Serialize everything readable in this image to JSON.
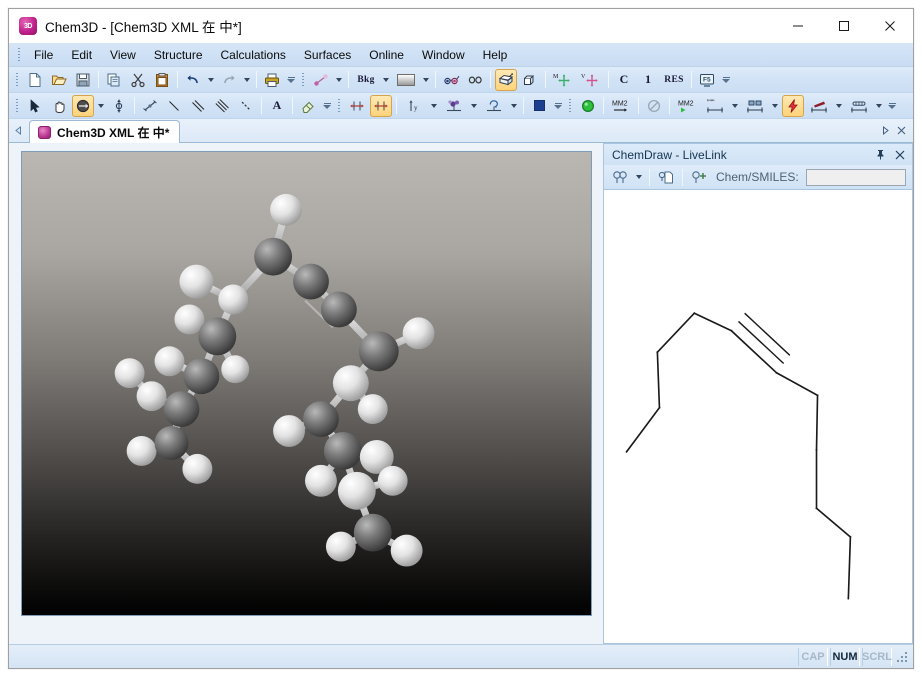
{
  "window": {
    "title": "Chem3D - [Chem3D XML 在  中*]",
    "app_icon_label": "3D",
    "controls": {
      "minimize": "Minimize",
      "maximize": "Maximize",
      "close": "Close"
    }
  },
  "menubar": {
    "items": [
      {
        "label": "File"
      },
      {
        "label": "Edit"
      },
      {
        "label": "View"
      },
      {
        "label": "Structure"
      },
      {
        "label": "Calculations"
      },
      {
        "label": "Surfaces"
      },
      {
        "label": "Online"
      },
      {
        "label": "Window"
      },
      {
        "label": "Help"
      }
    ]
  },
  "toolbar_main": {
    "buttons": [
      {
        "name": "new-document-button",
        "icon": "new-file-icon",
        "label": ""
      },
      {
        "name": "open-document-button",
        "icon": "open-folder-icon",
        "label": ""
      },
      {
        "name": "save-document-button",
        "icon": "save-disk-icon",
        "label": ""
      },
      {
        "name": "copy-button",
        "icon": "copy-icon",
        "label": ""
      },
      {
        "name": "cut-button",
        "icon": "scissors-icon",
        "label": ""
      },
      {
        "name": "paste-button",
        "icon": "clipboard-icon",
        "label": ""
      },
      {
        "name": "undo-button",
        "icon": "undo-arrow-icon",
        "label": ""
      },
      {
        "name": "redo-button",
        "icon": "redo-arrow-icon",
        "label": ""
      },
      {
        "name": "print-button",
        "icon": "printer-icon",
        "label": ""
      },
      {
        "name": "model-display-button",
        "icon": "ball-and-stick-icon",
        "label": ""
      },
      {
        "name": "background-color-button",
        "icon": "background-icon",
        "label": "Bkg"
      },
      {
        "name": "background-gradient-button",
        "icon": "gradient-swatch-icon",
        "label": ""
      },
      {
        "name": "stereo-glasses-button",
        "icon": "stereo-glasses-icon",
        "label": ""
      },
      {
        "name": "stereo-pair-button",
        "icon": "stereo-pair-icon",
        "label": ""
      },
      {
        "name": "perspective-box-button",
        "icon": "perspective-box-icon",
        "label": ""
      },
      {
        "name": "projection-box-button",
        "icon": "projection-box-icon",
        "label": ""
      },
      {
        "name": "move-model-button",
        "icon": "move-crosshair-icon",
        "label": "M"
      },
      {
        "name": "view-crosshair-button",
        "icon": "view-crosshair-icon",
        "label": "V"
      },
      {
        "name": "show-carbons-button",
        "icon": "carbon-label-icon",
        "label": "C"
      },
      {
        "name": "show-serial-numbers-button",
        "icon": "serial-number-icon",
        "label": "1"
      },
      {
        "name": "show-residues-button",
        "icon": "residue-label-icon",
        "label": "RES"
      },
      {
        "name": "fullscreen-button",
        "icon": "f5-screen-icon",
        "label": "F5"
      }
    ]
  },
  "toolbar_build": {
    "buttons": [
      {
        "name": "select-tool",
        "icon": "arrow-cursor-icon",
        "label": ""
      },
      {
        "name": "pan-tool",
        "icon": "hand-icon",
        "label": ""
      },
      {
        "name": "rotate-tool",
        "icon": "rotate-icon",
        "label": "",
        "active": true
      },
      {
        "name": "zoom-tool",
        "icon": "zoom-tool-icon",
        "label": ""
      },
      {
        "name": "translate-tool",
        "icon": "translate-icon",
        "label": ""
      },
      {
        "name": "single-bond-tool",
        "icon": "single-bond-icon",
        "label": ""
      },
      {
        "name": "double-bond-tool",
        "icon": "double-bond-icon",
        "label": ""
      },
      {
        "name": "triple-bond-tool",
        "icon": "triple-bond-icon",
        "label": ""
      },
      {
        "name": "dashed-bond-tool",
        "icon": "dashed-bond-icon",
        "label": ""
      },
      {
        "name": "text-tool",
        "icon": "text-a-icon",
        "label": "A"
      },
      {
        "name": "eraser-tool",
        "icon": "eraser-icon",
        "label": ""
      },
      {
        "name": "measure-distance-button",
        "icon": "measure-distance-icon",
        "label": ""
      },
      {
        "name": "measure-angle-button",
        "icon": "measure-angle-icon",
        "label": "",
        "active": true
      },
      {
        "name": "axis-tool-button",
        "icon": "axis-y-icon",
        "label": "y"
      },
      {
        "name": "atom-color-button",
        "icon": "atom-color-icon",
        "label": ""
      },
      {
        "name": "rotate-dial-button",
        "icon": "rotate-dial-icon",
        "label": ""
      },
      {
        "name": "solid-color-button",
        "icon": "solid-color-icon",
        "label": ""
      },
      {
        "name": "minimize-energy-button",
        "icon": "green-sphere-icon",
        "label": ""
      },
      {
        "name": "mm2-run-button",
        "icon": "mm2-arrow-icon",
        "label": "MM2"
      },
      {
        "name": "stop-calculation-button",
        "icon": "no-entry-icon",
        "label": ""
      },
      {
        "name": "mm2-play-button",
        "icon": "mm2-play-icon",
        "label": "MM2"
      },
      {
        "name": "trajectory-button",
        "icon": "trajectory-icon",
        "label": ""
      },
      {
        "name": "frames-button",
        "icon": "frames-icon",
        "label": ""
      },
      {
        "name": "lightning-button",
        "icon": "lightning-bolt-icon",
        "label": "",
        "active": true
      },
      {
        "name": "ribbon-button",
        "icon": "ribbon-icon",
        "label": ""
      },
      {
        "name": "capsule-button",
        "icon": "capsule-icon",
        "label": ""
      }
    ]
  },
  "document_tabs": {
    "scroll_left": "◁",
    "scroll_right": "▷",
    "close": "✕",
    "tabs": [
      {
        "label": "Chem3D XML 在  中*",
        "active": true
      }
    ]
  },
  "model_view": {
    "name": "3d-model-viewport",
    "background_top": "#bab7b2",
    "background_bottom": "#000000",
    "atom_carbon_color": "#6e6e6e",
    "atom_hydrogen_color": "#f2f2f2",
    "bond_color": "#cfcfcf"
  },
  "livelink": {
    "title": "ChemDraw - LiveLink",
    "pin": "📌",
    "close": "✕",
    "smiles_label": "Chem/SMILES:",
    "smiles_value": "",
    "smiles_placeholder": "",
    "toolbar_buttons": [
      {
        "name": "livelink-copy-structure-button",
        "icon": "double-ring-icon"
      },
      {
        "name": "livelink-paste-structure-button",
        "icon": "structure-page-icon"
      },
      {
        "name": "livelink-add-structure-button",
        "icon": "ring-plus-icon"
      }
    ],
    "structure_line_color": "#1a1a1a"
  },
  "statusbar": {
    "message": "",
    "indicators": [
      {
        "label": "CAP",
        "active": false
      },
      {
        "label": "NUM",
        "active": true
      },
      {
        "label": "SCRL",
        "active": false
      }
    ]
  }
}
